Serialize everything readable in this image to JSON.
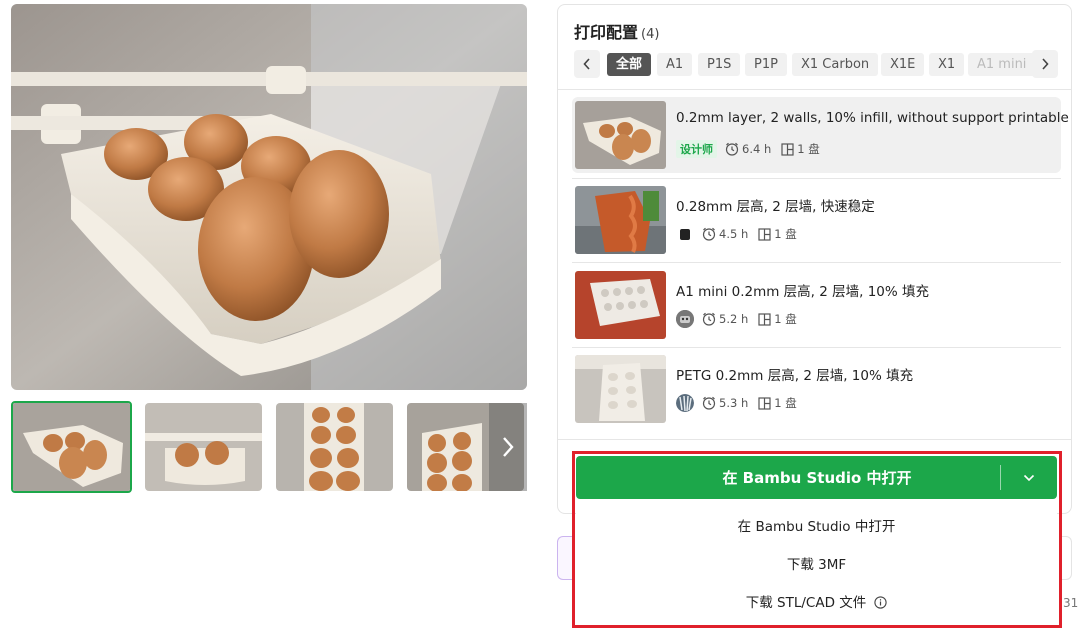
{
  "gallery": {
    "main_image": "egg-tray-photo",
    "thumbnails": [
      "egg-tray-thumb-1",
      "egg-tray-thumb-2",
      "egg-tray-thumb-3",
      "egg-tray-thumb-4"
    ],
    "next_icon": "chevron-right-icon"
  },
  "panel": {
    "title": "打印配置",
    "count": "(4)",
    "prev_icon": "chevron-left-icon",
    "next_icon": "chevron-right-icon",
    "filters": [
      {
        "label": "全部",
        "active": true
      },
      {
        "label": "A1"
      },
      {
        "label": "P1S"
      },
      {
        "label": "P1P"
      },
      {
        "label": "X1 Carbon"
      },
      {
        "label": "X1E"
      },
      {
        "label": "X1"
      },
      {
        "label": "A1 mini"
      }
    ],
    "profiles": [
      {
        "name": "0.2mm layer, 2 walls, 10% infill, without support printable",
        "badge": "设计师",
        "time": "6.4 h",
        "plates": "1 盘"
      },
      {
        "name": "0.28mm 层高, 2 层墙, 快速稳定",
        "time": "4.5 h",
        "plates": "1 盘"
      },
      {
        "name": "A1 mini 0.2mm 层高, 2 层墙, 10% 填充",
        "time": "5.2 h",
        "plates": "1 盘"
      },
      {
        "name": "PETG 0.2mm 层高, 2 层墙, 10% 填充",
        "time": "5.3 h",
        "plates": "1 盘"
      }
    ]
  },
  "open_button": {
    "label": "在 Bambu Studio 中打开",
    "caret_icon": "chevron-down-icon"
  },
  "dropdown": {
    "items": [
      "在 Bambu Studio 中打开",
      "下载 3MF",
      "下载 STL/CAD 文件"
    ],
    "info_icon": "info-circle-icon"
  },
  "footer_partial": "31",
  "colors": {
    "accent_green": "#1ca74a",
    "highlight_red": "#e0202b",
    "chip_active": "#555555"
  }
}
